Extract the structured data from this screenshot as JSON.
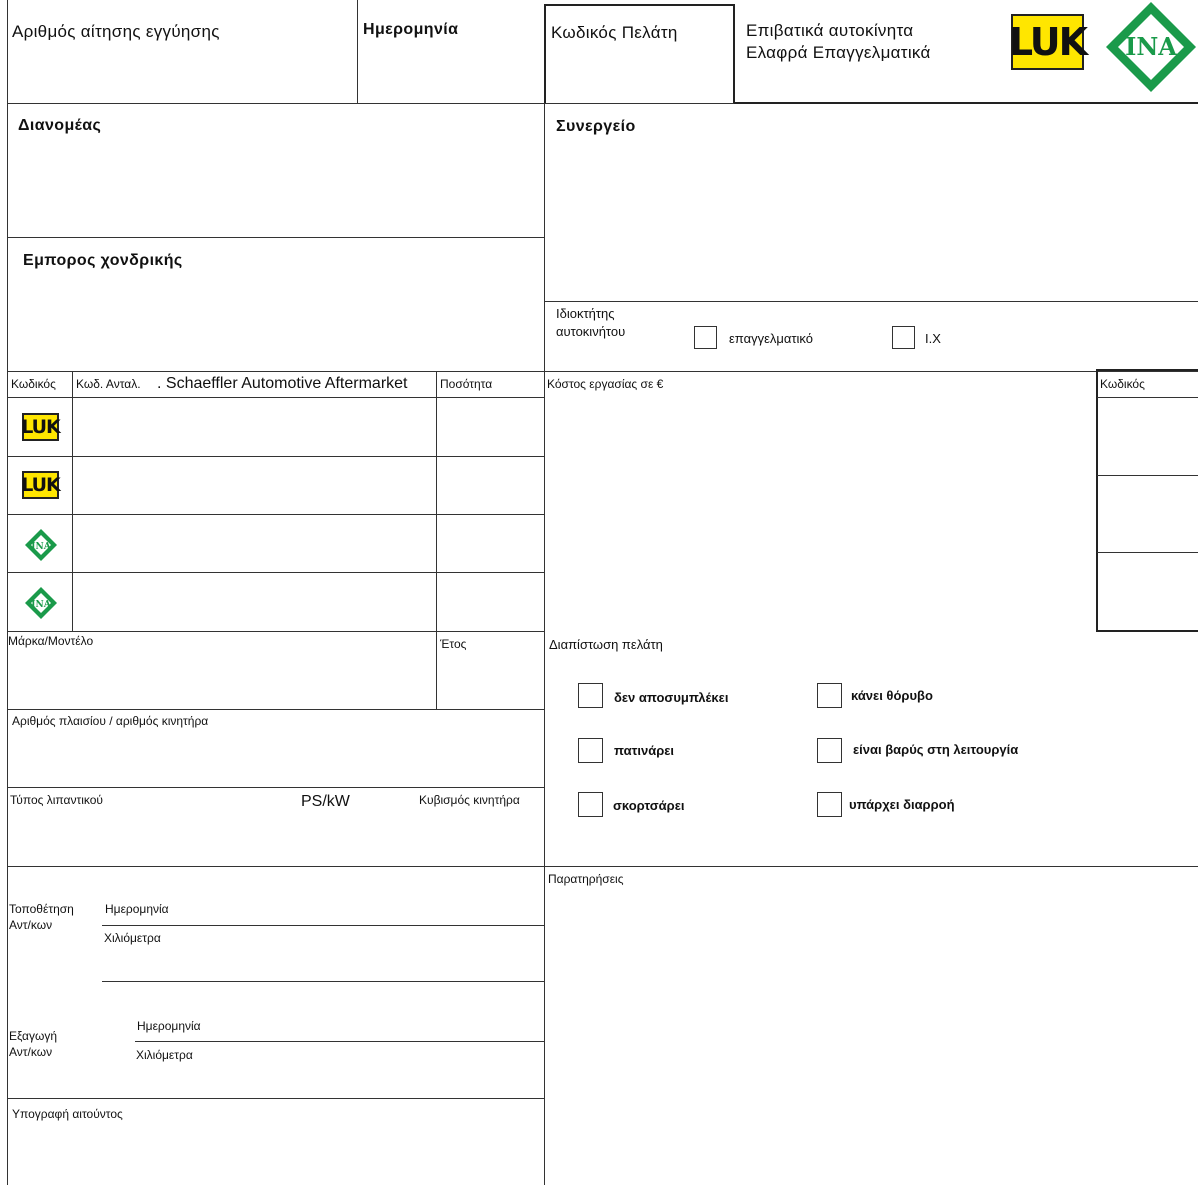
{
  "header": {
    "warranty_request_no": "Αριθμός αίτησης εγγύησης",
    "date": "Ημερομηνία",
    "customer_code": "Κωδικός Πελάτη",
    "category_line1": "Επιβατικά αυτοκίνητα",
    "category_line2": "Ελαφρά Επαγγελματικά",
    "logo_luk": "LUK",
    "logo_ina": "INA"
  },
  "parties": {
    "distributor": "Διανομέας",
    "wholesaler": "Εμπορος χονδρικής",
    "workshop": "Συνεργείο"
  },
  "owner": {
    "label_line1": "Ιδιοκτήτης",
    "label_line2": "αυτοκινήτου",
    "option_professional": "επαγγελματικό",
    "option_private": "Ι.Χ"
  },
  "parts_table": {
    "col_code": "Κωδικός",
    "col_part_code": "Κωδ. Ανταλ.",
    "col_brand": ". Schaeffler Automotive Aftermarket",
    "col_quantity": "Ποσότητα",
    "row_logos": [
      "LUK",
      "LUK",
      "INA",
      "INA"
    ]
  },
  "labor": {
    "cost_label": "Κόστος εργασίας σε €",
    "code_label": "Κωδικός"
  },
  "vehicle": {
    "make_model": "Μάρκα/Μοντέλο",
    "year": "Έτος",
    "vin_engine": "Αριθμός πλαισίου / αριθμός κινητήρα",
    "lubricant": "Τύπος λιπαντικού",
    "power": "PS/kW",
    "displacement": "Κυβισμός κινητήρα"
  },
  "diagnosis": {
    "title": "Διαπίστωση πελάτη",
    "options": [
      "δεν αποσυμπλέκει",
      "κάνει θόρυβο",
      "πατινάρει",
      "είναι βαρύς στη λειτουργία",
      "σκορτσάρει",
      "υπάρχει διαρροή"
    ]
  },
  "installation": {
    "label_line1": "Τοποθέτηση",
    "label_line2": "Αντ/κων",
    "date": "Ημερομηνία",
    "km": "Χιλιόμετρα"
  },
  "removal": {
    "label_line1": "Εξαγωγή",
    "label_line2": "Αντ/κων",
    "date": "Ημερομηνία",
    "km": "Χιλιόμετρα"
  },
  "remarks": "Παρατηρήσεις",
  "signature": "Υπογραφή αιτούντος",
  "colors": {
    "luk_yellow": "#ffe600",
    "ina_green": "#1a9a4a",
    "line": "#333333"
  }
}
